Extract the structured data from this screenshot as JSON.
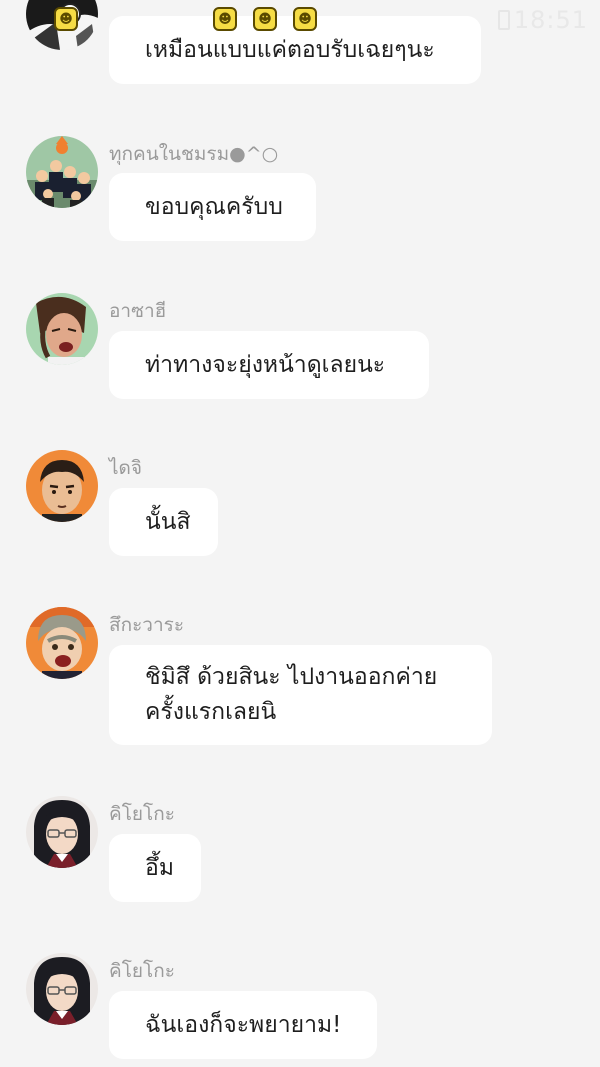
{
  "status_bar": {
    "time": "18:51",
    "emoji_icons": [
      "grinning-face-icon",
      "grinning-face-icon",
      "grinning-face-icon",
      "grinning-face-icon"
    ]
  },
  "messages": [
    {
      "sender": "",
      "text": "เหมือนแบบแค่ตอบรับเฉยๆนะ",
      "avatar": "manga-character-avatar"
    },
    {
      "sender": "ทุกคนในชมรม●^○",
      "text": "ขอบคุณครับบ",
      "avatar": "team-group-avatar"
    },
    {
      "sender": "อาซาฮี",
      "text": "ท่าทางจะยุ่งหน้าดูเลยนะ",
      "avatar": "asahi-avatar"
    },
    {
      "sender": "ไดจิ",
      "text": "นั้นสิ",
      "avatar": "daichi-avatar"
    },
    {
      "sender": "สึกะวาระ",
      "lines": [
        "ชิมิสึ ด้วยสินะ ไปงานออกค่าย",
        "ครั้งแรกเลยนิ"
      ],
      "avatar": "sugawara-avatar"
    },
    {
      "sender": "คิโยโกะ",
      "text": "อึ้ม",
      "avatar": "kiyoko-avatar"
    },
    {
      "sender": "คิโยโกะ",
      "text": "ฉันเองก็จะพยายาม!",
      "avatar": "kiyoko-avatar"
    }
  ]
}
